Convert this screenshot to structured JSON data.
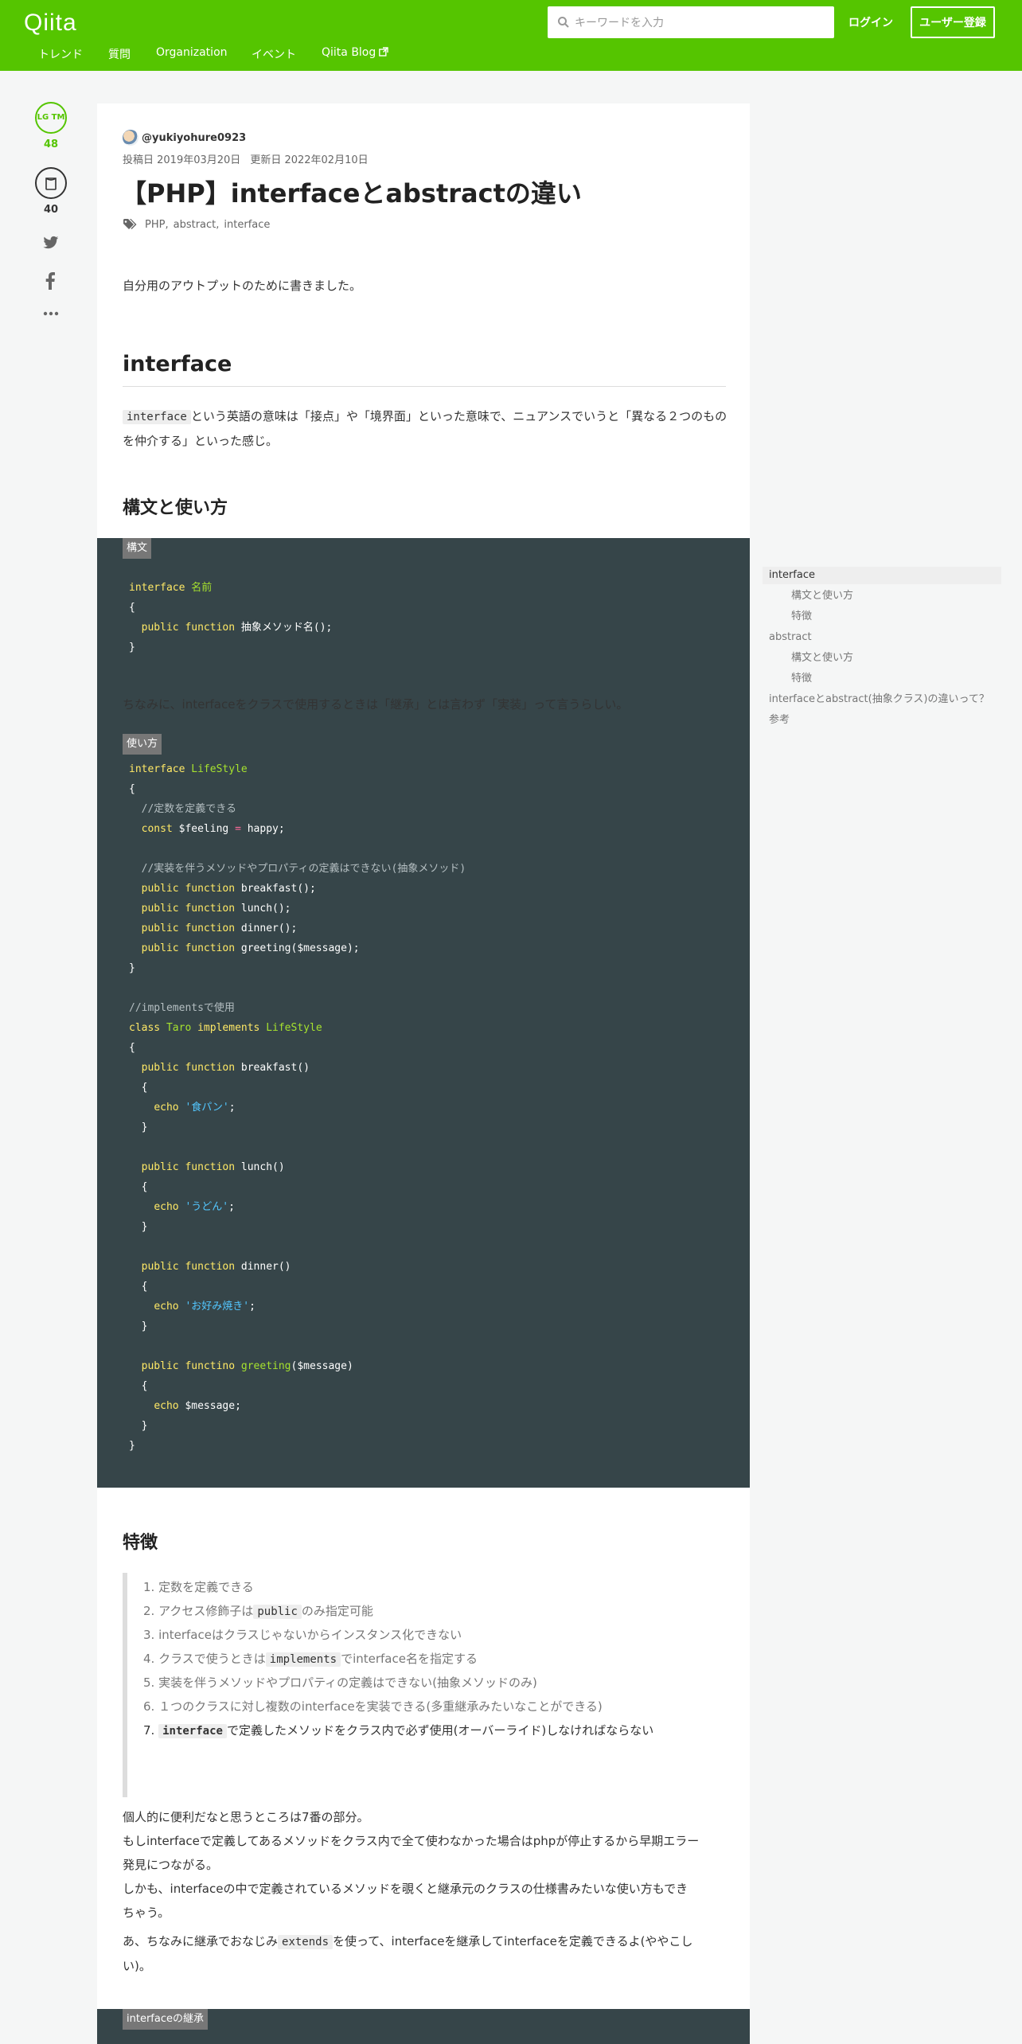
{
  "header": {
    "logo": "Qiita",
    "search_placeholder": "キーワードを入力",
    "login_label": "ログイン",
    "signup_label": "ユーザー登録",
    "nav": [
      "トレンド",
      "質問",
      "Organization",
      "イベント",
      "Qiita Blog"
    ],
    "brand_color": "#55c500"
  },
  "actions": {
    "lgtm_label": "LG TM",
    "lgtm_count": "48",
    "stock_count": "40"
  },
  "article": {
    "author": "@yukiyohure0923",
    "posted": "投稿日 2019年03月20日",
    "updated": "更新日 2022年02月10日",
    "title": "【PHP】interfaceとabstractの違い",
    "tags": [
      "PHP",
      "abstract",
      "interface"
    ],
    "intro": "自分用のアウトプットのために書きました。",
    "h2_interface": "interface",
    "p1_code": "interface",
    "p1_rest": "という英語の意味は「接点」や「境界面」といった意味で、ニュアンスでいうと「異なる２つのものを仲介する」といった感じ。",
    "h3_syntax": "構文と使い方",
    "code1_label": "構文",
    "p2": "ちなみに、interfaceをクラスで使用するときは「継承」とは言わず「実装」って言うらしい。",
    "code2_label": "使い方",
    "h3_features": "特徴",
    "features": [
      {
        "pre": "1. 定数を定義できる",
        "code": "",
        "post": ""
      },
      {
        "pre": "2. アクセス修飾子は",
        "code": "public",
        "post": "のみ指定可能"
      },
      {
        "pre": "3. interfaceはクラスじゃないからインスタンス化できない",
        "code": "",
        "post": ""
      },
      {
        "pre": "4. クラスで使うときは",
        "code": "implements",
        "post": "でinterface名を指定する"
      },
      {
        "pre": "5. 実装を伴うメソッドやプロパティの定義はできない(抽象メソッドのみ)",
        "code": "",
        "post": ""
      },
      {
        "pre": "6. １つのクラスに対し複数のinterfaceを実装できる(多重継承みたいなことができる)",
        "code": "",
        "post": ""
      },
      {
        "pre": "7. ",
        "code": "interface",
        "post": "で定義したメソッドをクラス内で必ず使用(オーバーライド)しなければならない"
      }
    ],
    "p3_lines": [
      "個人的に便利だなと思うところは7番の部分。",
      "もしinterfaceで定義してあるメソッドをクラス内で全て使わなかった場合はphpが停止するから早期エラー",
      "発見につながる。",
      "しかも、interfaceの中で定義されているメソッドを覗くと継承元のクラスの仕様書みたいな使い方もでき",
      "ちゃう。"
    ],
    "p4_pre": "あ、ちなみに継承でおなじみ",
    "p4_code": "extends",
    "p4_post": "を使って、interfaceを継承してinterfaceを定義できるよ(ややこし",
    "p4_line2": "い)。",
    "code3_label": "interfaceの継承"
  },
  "code1": [
    [
      [
        "k",
        "interface "
      ],
      [
        "t",
        "名前"
      ]
    ],
    [
      [
        "p",
        "{"
      ]
    ],
    [
      [
        "p",
        "  "
      ],
      [
        "k",
        "public function "
      ],
      [
        "p",
        "抽象メソッド名();"
      ]
    ],
    [
      [
        "p",
        "}"
      ]
    ]
  ],
  "code2": [
    [
      [
        "k",
        "interface "
      ],
      [
        "t",
        "LifeStyle"
      ]
    ],
    [
      [
        "p",
        "{"
      ]
    ],
    [
      [
        "c",
        "  //定数を定義できる"
      ]
    ],
    [
      [
        "p",
        "  "
      ],
      [
        "k",
        "const "
      ],
      [
        "p",
        "$feeling "
      ],
      [
        "o",
        "="
      ],
      [
        "p",
        " happy;"
      ]
    ],
    [
      [
        "p",
        ""
      ]
    ],
    [
      [
        "c",
        "  //実装を伴うメソッドやプロパティの定義はできない(抽象メソッド)"
      ]
    ],
    [
      [
        "p",
        "  "
      ],
      [
        "k",
        "public function "
      ],
      [
        "p",
        "breakfast();"
      ]
    ],
    [
      [
        "p",
        "  "
      ],
      [
        "k",
        "public function "
      ],
      [
        "p",
        "lunch();"
      ]
    ],
    [
      [
        "p",
        "  "
      ],
      [
        "k",
        "public function "
      ],
      [
        "p",
        "dinner();"
      ]
    ],
    [
      [
        "p",
        "  "
      ],
      [
        "k",
        "public function "
      ],
      [
        "p",
        "greeting($message);"
      ]
    ],
    [
      [
        "p",
        "}"
      ]
    ],
    [
      [
        "p",
        ""
      ]
    ],
    [
      [
        "c",
        "//implementsで使用"
      ]
    ],
    [
      [
        "k",
        "class "
      ],
      [
        "t",
        "Taro "
      ],
      [
        "k",
        "implements "
      ],
      [
        "t",
        "LifeStyle"
      ]
    ],
    [
      [
        "p",
        "{"
      ]
    ],
    [
      [
        "p",
        "  "
      ],
      [
        "k",
        "public function "
      ],
      [
        "p",
        "breakfast()"
      ]
    ],
    [
      [
        "p",
        "  {"
      ]
    ],
    [
      [
        "p",
        "    "
      ],
      [
        "k",
        "echo "
      ],
      [
        "s",
        "'食パン'"
      ],
      [
        "p",
        ";"
      ]
    ],
    [
      [
        "p",
        "  }"
      ]
    ],
    [
      [
        "p",
        ""
      ]
    ],
    [
      [
        "p",
        "  "
      ],
      [
        "k",
        "public function "
      ],
      [
        "p",
        "lunch()"
      ]
    ],
    [
      [
        "p",
        "  {"
      ]
    ],
    [
      [
        "p",
        "    "
      ],
      [
        "k",
        "echo "
      ],
      [
        "s",
        "'うどん'"
      ],
      [
        "p",
        ";"
      ]
    ],
    [
      [
        "p",
        "  }"
      ]
    ],
    [
      [
        "p",
        ""
      ]
    ],
    [
      [
        "p",
        "  "
      ],
      [
        "k",
        "public function "
      ],
      [
        "p",
        "dinner()"
      ]
    ],
    [
      [
        "p",
        "  {"
      ]
    ],
    [
      [
        "p",
        "    "
      ],
      [
        "k",
        "echo "
      ],
      [
        "s",
        "'お好み焼き'"
      ],
      [
        "p",
        ";"
      ]
    ],
    [
      [
        "p",
        "  }"
      ]
    ],
    [
      [
        "p",
        ""
      ]
    ],
    [
      [
        "p",
        "  "
      ],
      [
        "k",
        "public functino "
      ],
      [
        "t",
        "greeting"
      ],
      [
        "p",
        "($message)"
      ]
    ],
    [
      [
        "p",
        "  {"
      ]
    ],
    [
      [
        "p",
        "    "
      ],
      [
        "k",
        "echo "
      ],
      [
        "p",
        "$message;"
      ]
    ],
    [
      [
        "p",
        "  }"
      ]
    ],
    [
      [
        "p",
        "}"
      ]
    ]
  ],
  "toc": [
    {
      "label": "interface",
      "level": 1,
      "active": true
    },
    {
      "label": "構文と使い方",
      "level": 2,
      "active": false
    },
    {
      "label": "特徴",
      "level": 2,
      "active": false
    },
    {
      "label": "abstract",
      "level": 1,
      "active": false
    },
    {
      "label": "構文と使い方",
      "level": 2,
      "active": false
    },
    {
      "label": "特徴",
      "level": 2,
      "active": false
    },
    {
      "label": "interfaceとabstract(抽象クラス)の違いって？",
      "level": 1,
      "active": false
    },
    {
      "label": "参考",
      "level": 1,
      "active": false
    }
  ]
}
